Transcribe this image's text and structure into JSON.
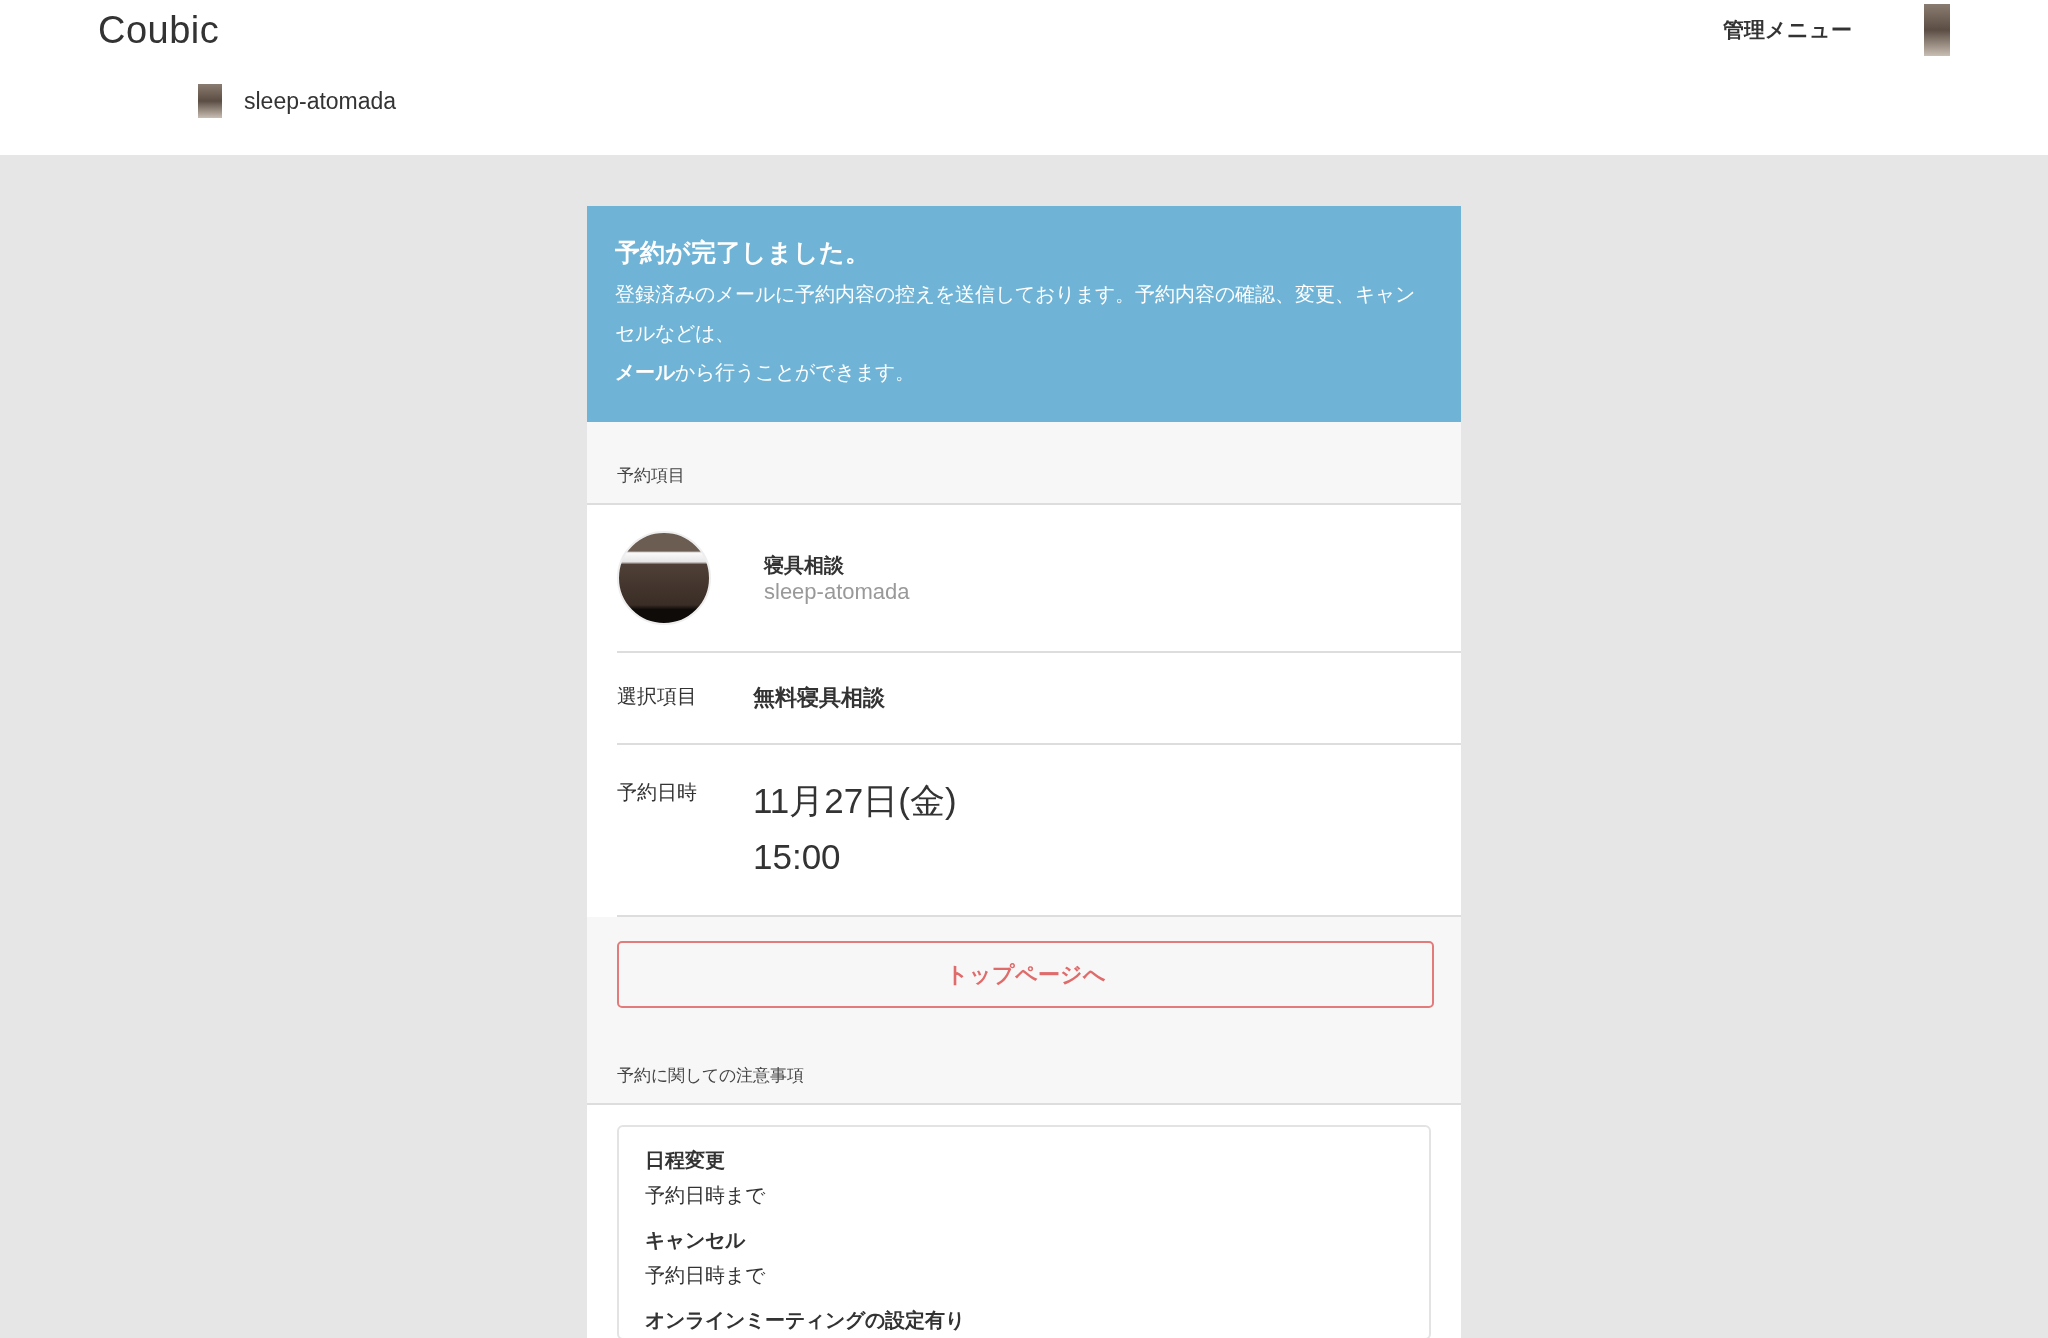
{
  "header": {
    "logo": "Coubic",
    "admin_menu": "管理メニュー",
    "shop_name": "sleep-atomada"
  },
  "banner": {
    "title": "予約が完了しました。",
    "paragraphs": [
      "登録済みのメールに予約内容の控えを送信しております。予約内容の確認、変更、キャンセルなどは、",
      "**メール**から行うことができます。"
    ]
  },
  "booking": {
    "section_title": "予約項目",
    "service_name": "寝具相談",
    "service_shop": "sleep-atomada",
    "rows": [
      {
        "kind": "text",
        "label": "選択項目",
        "values": [
          "無料寝具相談"
        ]
      },
      {
        "kind": "datetime",
        "label": "予約日時",
        "values": [
          "11月27日(金)",
          "15:00"
        ]
      }
    ]
  },
  "top_button": "トップページへ",
  "notes": {
    "section_title": "予約に関しての注意事項",
    "items": [
      {
        "title": "日程変更",
        "value": "予約日時まで"
      },
      {
        "title": "キャンセル",
        "value": "予約日時まで"
      },
      {
        "title": "オンラインミーティングの設定有り"
      }
    ]
  }
}
